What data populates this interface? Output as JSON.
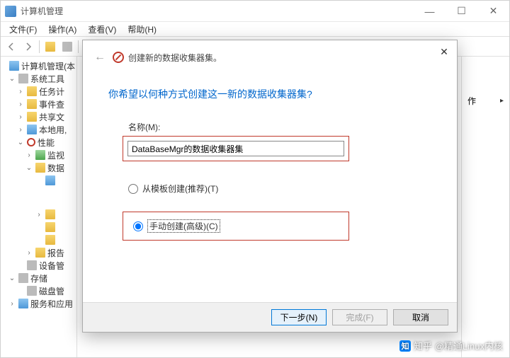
{
  "window": {
    "title": "计算机管理",
    "controls": {
      "min": "—",
      "max": "☐",
      "close": "✕"
    }
  },
  "menubar": {
    "file": "文件(F)",
    "action": "操作(A)",
    "view": "查看(V)",
    "help": "帮助(H)"
  },
  "tree": {
    "root": "计算机管理(本",
    "system_tools": "系统工具",
    "task_scheduler": "任务计",
    "event_viewer": "事件查",
    "shared_folders": "共享文",
    "local_users": "本地用,",
    "performance": "性能",
    "monitoring": "监视",
    "data": "数据",
    "reports": "报告",
    "device_manager": "设备管",
    "storage": "存储",
    "disk_mgmt": "磁盘管",
    "services": "服务和应用"
  },
  "right": {
    "action_label": "作"
  },
  "dialog": {
    "header": "创建新的数据收集器集。",
    "question": "你希望以何种方式创建这一新的数据收集器集?",
    "name_label": "名称(M):",
    "name_value": "DataBaseMgr的数据收集器集",
    "radio_template": "从模板创建(推荐)(T)",
    "radio_manual": "手动创建(高级)(C)",
    "btn_next": "下一步(N)",
    "btn_finish": "完成(F)",
    "btn_cancel": "取消"
  },
  "watermark": "知乎 @精通Linux内核"
}
